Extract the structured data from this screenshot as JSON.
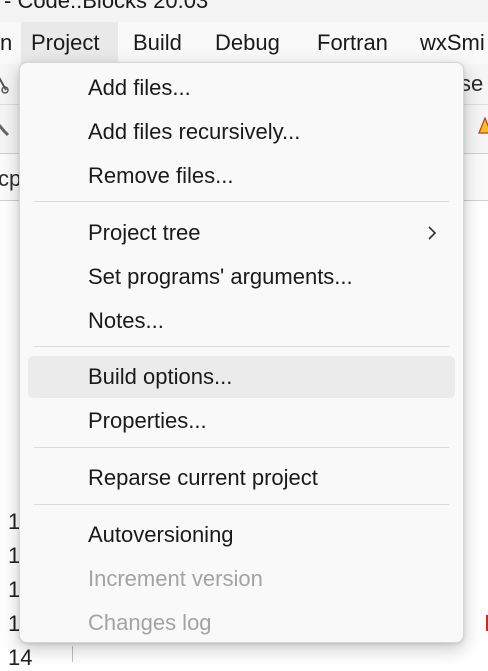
{
  "window": {
    "title": "- Code::Blocks 20.03"
  },
  "menubar": {
    "items": [
      {
        "label": "n"
      },
      {
        "label": "Project"
      },
      {
        "label": "Build"
      },
      {
        "label": "Debug"
      },
      {
        "label": "Fortran"
      },
      {
        "label": "wxSmi"
      }
    ]
  },
  "background": {
    "toolbar_fragment": "se",
    "tab_fragment": "cp",
    "line_numbers": [
      "1",
      "1",
      "1",
      "1",
      "14"
    ]
  },
  "project_menu": {
    "groups": [
      {
        "items": [
          {
            "label": "Add files...",
            "enabled": true
          },
          {
            "label": "Add files recursively...",
            "enabled": true
          },
          {
            "label": "Remove files...",
            "enabled": true
          }
        ]
      },
      {
        "items": [
          {
            "label": "Project tree",
            "enabled": true,
            "submenu": true
          },
          {
            "label": "Set programs' arguments...",
            "enabled": true
          },
          {
            "label": "Notes...",
            "enabled": true
          }
        ]
      },
      {
        "items": [
          {
            "label": "Build options...",
            "enabled": true,
            "highlighted": true
          },
          {
            "label": "Properties...",
            "enabled": true
          }
        ]
      },
      {
        "items": [
          {
            "label": "Reparse current project",
            "enabled": true
          }
        ]
      },
      {
        "items": [
          {
            "label": "Autoversioning",
            "enabled": true
          },
          {
            "label": "Increment version",
            "enabled": false
          },
          {
            "label": "Changes log",
            "enabled": false
          }
        ]
      }
    ]
  }
}
